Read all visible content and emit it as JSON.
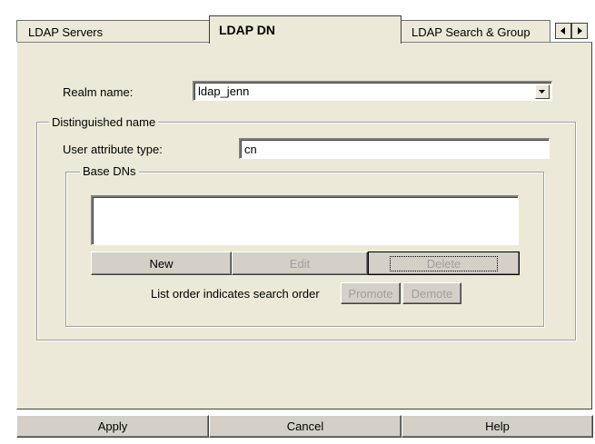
{
  "tabs": [
    {
      "label": "LDAP Servers",
      "active": false
    },
    {
      "label": "LDAP DN",
      "active": true
    },
    {
      "label": "LDAP Search & Group",
      "active": false
    }
  ],
  "tab_scroll": {
    "left_icon": "triangle-left-icon",
    "right_icon": "triangle-right-icon"
  },
  "realm": {
    "label": "Realm name:",
    "value": "ldap_jenn",
    "dropdown_icon": "chevron-down-icon"
  },
  "distinguished_name": {
    "title": "Distinguished name",
    "user_attribute_label": "User attribute type:",
    "user_attribute_value": "cn",
    "base_dns": {
      "title": "Base DNs",
      "items": [],
      "buttons": {
        "new": "New",
        "edit": "Edit",
        "delete": "Delete"
      },
      "order_label": "List order indicates search order",
      "promote": "Promote",
      "demote": "Demote"
    }
  },
  "footer": {
    "apply": "Apply",
    "cancel": "Cancel",
    "help": "Help"
  },
  "colors": {
    "panel": "#ece9d8",
    "button": "#d4d0c8",
    "disabled_text": "#a0a0a0"
  }
}
